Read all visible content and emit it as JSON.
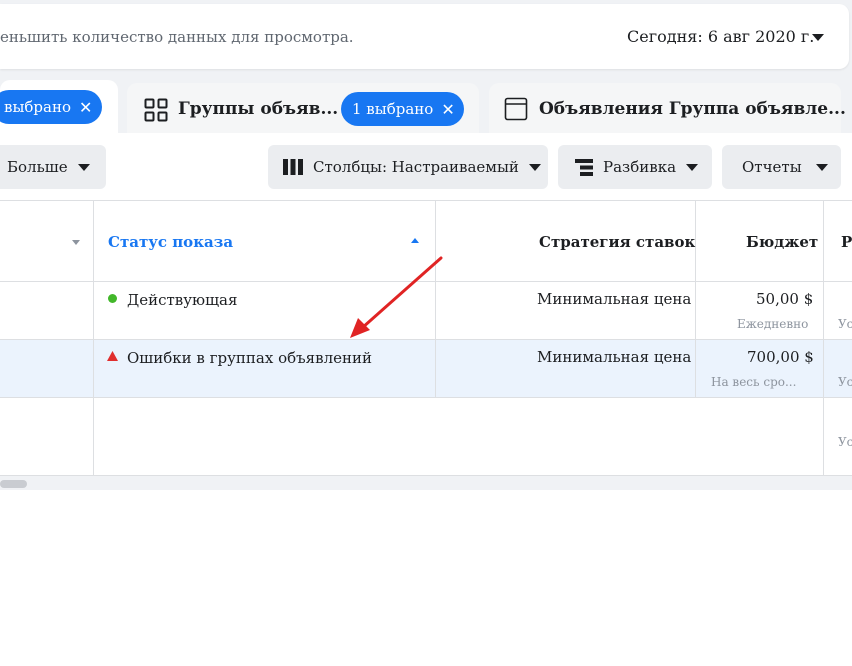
{
  "notice": {
    "text": "еньшить количество данных для просмотра.",
    "date": "Сегодня: 6 авг 2020 г."
  },
  "tabs": [
    {
      "title": "",
      "badge": "выбрано"
    },
    {
      "title": "Группы объяв...",
      "badge": "1 выбрано",
      "icon": "grid-icon"
    },
    {
      "title": "Объявления Группа объявле...",
      "icon": "window-icon"
    }
  ],
  "toolbar": {
    "more": "Больше",
    "columns": "Столбцы: Настраиваемый",
    "breakdown": "Разбивка",
    "reports": "Отчеты"
  },
  "table": {
    "headers": {
      "status": "Статус показа",
      "strategy": "Стратегия ставок",
      "budget": "Бюджет",
      "results": "Р"
    },
    "rows": [
      {
        "status": "Действующая",
        "status_color": "#42b72a",
        "strategy": "Минимальная цена",
        "budget": "50,00 $",
        "budget_sub": "Ежедневно",
        "results_sub": "Ус"
      },
      {
        "status": "Ошибки в группах объявлений",
        "status_color": "#e02e2e",
        "strategy": "Минимальная цена",
        "budget": "700,00 $",
        "budget_sub": "На весь сро...",
        "results_sub": "Ус"
      },
      {
        "results_sub": "Ус"
      }
    ]
  },
  "colors": {
    "accent": "#1877f2",
    "annotation_arrow": "#e02424"
  }
}
